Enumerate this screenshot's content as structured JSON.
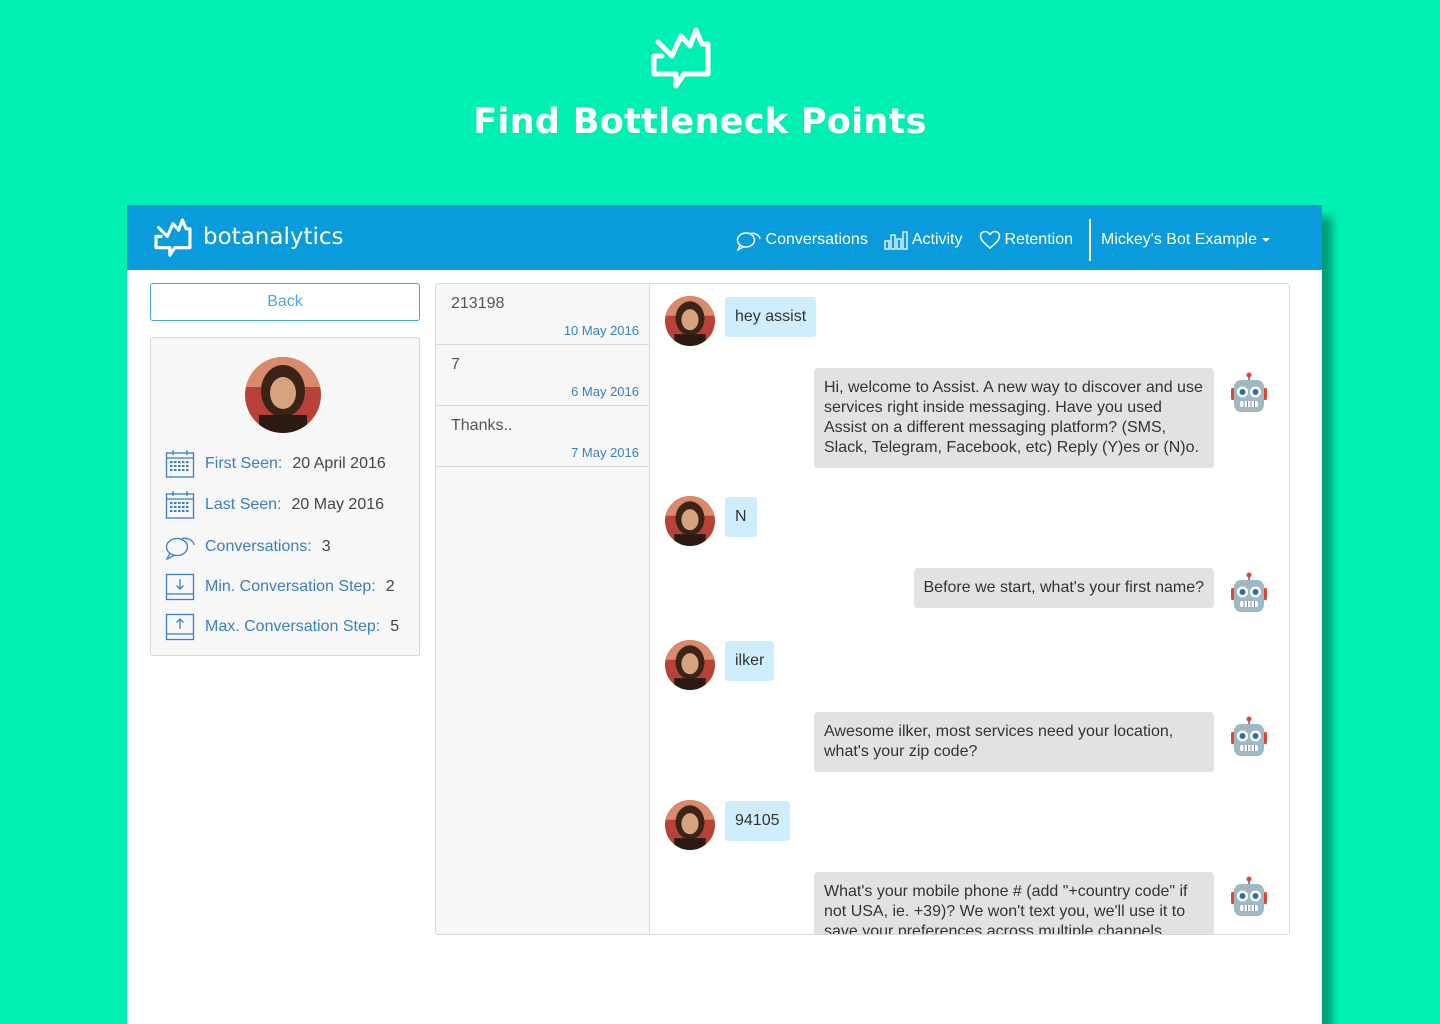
{
  "hero": {
    "title": "Find Bottleneck Points"
  },
  "app": {
    "brand": "botanalytics",
    "nav": {
      "conversations": "Conversations",
      "activity": "Activity",
      "retention": "Retention",
      "bot_select": "Mickey's Bot Example"
    },
    "back_label": "Back",
    "profile": {
      "stats": [
        {
          "label": "First Seen:",
          "value": "20 April 2016",
          "icon": "calendar-icon"
        },
        {
          "label": "Last Seen:",
          "value": "20 May 2016",
          "icon": "calendar-icon"
        },
        {
          "label": "Conversations:",
          "value": "3",
          "icon": "chat-bubbles-icon"
        },
        {
          "label": "Min. Conversation Step:",
          "value": "2",
          "icon": "download-icon"
        },
        {
          "label": "Max. Conversation Step:",
          "value": "5",
          "icon": "upload-icon"
        }
      ]
    },
    "conversations": [
      {
        "title": "213198",
        "date": "10 May 2016"
      },
      {
        "title": "7",
        "date": "6 May 2016"
      },
      {
        "title": "Thanks..",
        "date": "7 May 2016"
      }
    ],
    "messages": [
      {
        "from": "user",
        "text": "hey assist"
      },
      {
        "from": "bot",
        "text": "Hi, welcome to Assist. A new way to discover and use services right inside messaging. Have you used Assist on a different messaging platform? (SMS, Slack, Telegram, Facebook, etc) Reply (Y)es or (N)o."
      },
      {
        "from": "user",
        "text": "N"
      },
      {
        "from": "bot",
        "text": "Before we start, what's your first name?"
      },
      {
        "from": "user",
        "text": "ilker"
      },
      {
        "from": "bot",
        "text": "Awesome ilker, most services need your location, what's your zip code?"
      },
      {
        "from": "user",
        "text": "94105"
      },
      {
        "from": "bot",
        "text": "What's your mobile phone # (add \"+country code\" if not USA, ie. +39)? We won't text you, we'll use it to save your preferences across multiple channels."
      }
    ],
    "colors": {
      "background": "#00efb2",
      "topbar": "#0a9bdc",
      "user_bubble": "#cfeefd",
      "bot_bubble": "#e2e2e2",
      "accent_text": "#3a7fc4"
    }
  }
}
